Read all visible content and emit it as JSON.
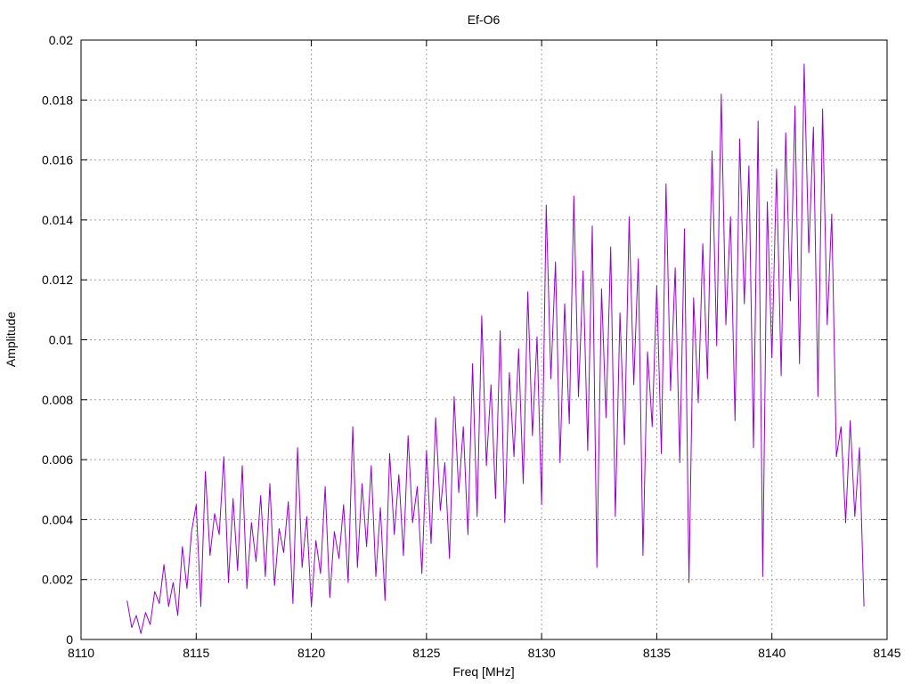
{
  "chart_data": {
    "type": "line",
    "title": "Ef-O6",
    "xlabel": "Freq [MHz]",
    "ylabel": "Amplitude",
    "xlim": [
      8110,
      8145
    ],
    "ylim": [
      0,
      0.02
    ],
    "xticks": [
      8110,
      8115,
      8120,
      8125,
      8130,
      8135,
      8140,
      8145
    ],
    "xtick_labels": [
      "8110",
      "8115",
      "8120",
      "8125",
      "8130",
      "8135",
      "8140",
      "8145"
    ],
    "yticks": [
      0,
      0.002,
      0.004,
      0.006,
      0.008,
      0.01,
      0.012,
      0.014,
      0.016,
      0.018,
      0.02
    ],
    "ytick_labels": [
      "0",
      "0.002",
      "0.004",
      "0.006",
      "0.008",
      "0.01",
      "0.012",
      "0.014",
      "0.016",
      "0.018",
      "0.02"
    ],
    "grid": true,
    "legend": "none",
    "series": [
      {
        "color": "#9400d3",
        "x": [
          8112.0,
          8112.2,
          8112.4,
          8112.6,
          8112.8,
          8113.0,
          8113.2,
          8113.4,
          8113.6,
          8113.8,
          8114.0,
          8114.2,
          8114.4,
          8114.6,
          8114.8,
          8115.0,
          8115.2,
          8115.4,
          8115.6,
          8115.8,
          8116.0,
          8116.2,
          8116.4,
          8116.6,
          8116.8,
          8117.0,
          8117.2,
          8117.4,
          8117.6,
          8117.8,
          8118.0,
          8118.2,
          8118.4,
          8118.6,
          8118.8,
          8119.0,
          8119.2,
          8119.4,
          8119.6,
          8119.8,
          8120.0,
          8120.2,
          8120.4,
          8120.6,
          8120.8,
          8121.0,
          8121.2,
          8121.4,
          8121.6,
          8121.8,
          8122.0,
          8122.2,
          8122.4,
          8122.6,
          8122.8,
          8123.0,
          8123.2,
          8123.4,
          8123.6,
          8123.8,
          8124.0,
          8124.2,
          8124.4,
          8124.6,
          8124.8,
          8125.0,
          8125.2,
          8125.4,
          8125.6,
          8125.8,
          8126.0,
          8126.2,
          8126.4,
          8126.6,
          8126.8,
          8127.0,
          8127.2,
          8127.4,
          8127.6,
          8127.8,
          8128.0,
          8128.2,
          8128.4,
          8128.6,
          8128.8,
          8129.0,
          8129.2,
          8129.4,
          8129.6,
          8129.8,
          8130.0,
          8130.2,
          8130.4,
          8130.6,
          8130.8,
          8131.0,
          8131.2,
          8131.4,
          8131.6,
          8131.8,
          8132.0,
          8132.2,
          8132.4,
          8132.6,
          8132.8,
          8133.0,
          8133.2,
          8133.4,
          8133.6,
          8133.8,
          8134.0,
          8134.2,
          8134.4,
          8134.6,
          8134.8,
          8135.0,
          8135.2,
          8135.4,
          8135.6,
          8135.8,
          8136.0,
          8136.2,
          8136.4,
          8136.6,
          8136.8,
          8137.0,
          8137.2,
          8137.4,
          8137.6,
          8137.8,
          8138.0,
          8138.2,
          8138.4,
          8138.6,
          8138.8,
          8139.0,
          8139.2,
          8139.4,
          8139.6,
          8139.8,
          8140.0,
          8140.2,
          8140.4,
          8140.6,
          8140.8,
          8141.0,
          8141.2,
          8141.4,
          8141.6,
          8141.8,
          8142.0,
          8142.2,
          8142.4,
          8142.6,
          8142.8,
          8143.0,
          8143.2,
          8143.4,
          8143.6,
          8143.8,
          8144.0
        ],
        "y": [
          0.0013,
          0.0004,
          0.0008,
          0.0002,
          0.0009,
          0.0005,
          0.0016,
          0.0012,
          0.0025,
          0.0011,
          0.0019,
          0.0008,
          0.0031,
          0.0017,
          0.0036,
          0.0045,
          0.0011,
          0.0056,
          0.0028,
          0.0042,
          0.0035,
          0.0061,
          0.0019,
          0.0047,
          0.0023,
          0.0058,
          0.0017,
          0.0039,
          0.0026,
          0.0048,
          0.0021,
          0.0052,
          0.0018,
          0.0037,
          0.0029,
          0.0046,
          0.0012,
          0.0064,
          0.0024,
          0.0041,
          0.0011,
          0.0033,
          0.0022,
          0.0051,
          0.0014,
          0.0036,
          0.0027,
          0.0045,
          0.0019,
          0.0071,
          0.0024,
          0.0052,
          0.0031,
          0.0058,
          0.0021,
          0.0044,
          0.0013,
          0.0062,
          0.0035,
          0.0055,
          0.0028,
          0.0068,
          0.0039,
          0.0051,
          0.0022,
          0.0063,
          0.0032,
          0.0074,
          0.0043,
          0.0059,
          0.0027,
          0.0081,
          0.0049,
          0.0071,
          0.0035,
          0.0092,
          0.0041,
          0.0108,
          0.0058,
          0.0085,
          0.0047,
          0.0103,
          0.0039,
          0.0089,
          0.0061,
          0.0097,
          0.0052,
          0.0116,
          0.0068,
          0.0101,
          0.0045,
          0.0145,
          0.0087,
          0.0126,
          0.0059,
          0.0112,
          0.0072,
          0.0148,
          0.0081,
          0.0123,
          0.0063,
          0.0138,
          0.0024,
          0.0117,
          0.0074,
          0.0131,
          0.0041,
          0.0109,
          0.0065,
          0.0141,
          0.0085,
          0.0127,
          0.0028,
          0.0096,
          0.0071,
          0.0118,
          0.0062,
          0.0152,
          0.0083,
          0.0124,
          0.0059,
          0.0137,
          0.0019,
          0.0114,
          0.0079,
          0.0132,
          0.0087,
          0.0163,
          0.0098,
          0.0182,
          0.0105,
          0.0141,
          0.0073,
          0.0167,
          0.0112,
          0.0158,
          0.0064,
          0.0173,
          0.0021,
          0.0146,
          0.0094,
          0.0157,
          0.0088,
          0.0169,
          0.0113,
          0.0178,
          0.0092,
          0.0192,
          0.0129,
          0.0171,
          0.0081,
          0.0177,
          0.0105,
          0.0142,
          0.0061,
          0.0071,
          0.0039,
          0.0073,
          0.0041,
          0.0064,
          0.0011
        ]
      }
    ]
  }
}
